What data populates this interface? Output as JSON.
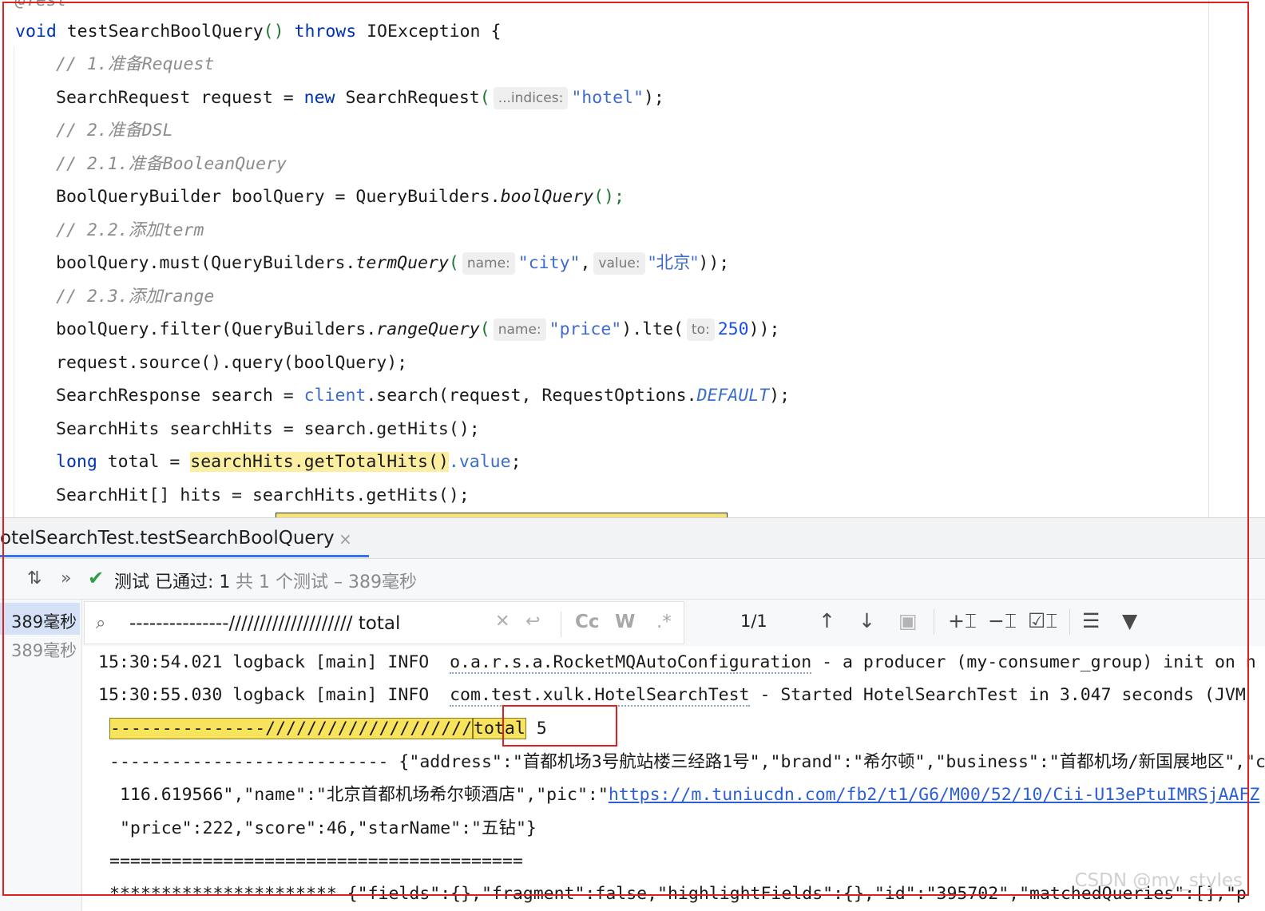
{
  "editor": {
    "line_prev_annotation": "@Test",
    "lines": {
      "method_void": "void",
      "method_name": " testSearchBoolQuery",
      "method_parens": "()",
      "method_throws": " throws",
      "method_exception": " IOException {",
      "comment1": "// 1.准备Request",
      "req_type": "SearchRequest request = ",
      "req_new": "new",
      "req_ctor": " SearchRequest",
      "req_open": "(",
      "req_hint": "...indices:",
      "req_arg": "\"hotel\"",
      "req_close": ");",
      "comment2": "// 2.准备DSL",
      "comment21": "// 2.1.准备BooleanQuery",
      "bq_prefix": "BoolQueryBuilder boolQuery = QueryBuilders.",
      "bq_method": "boolQuery",
      "bq_suffix": "();",
      "comment22": "// 2.2.添加term",
      "must_prefix": "boolQuery.must(QueryBuilders.",
      "must_method": "termQuery",
      "must_open": "(",
      "must_hint1": "name:",
      "must_arg1": "\"city\"",
      "must_comma": ",",
      "must_hint2": "value:",
      "must_arg2": "\"北京\"",
      "must_close": "));",
      "comment23": "// 2.3.添加range",
      "filter_prefix": "boolQuery.filter(QueryBuilders.",
      "filter_method": "rangeQuery",
      "filter_open": "(",
      "filter_hint1": "name:",
      "filter_arg1": "\"price\"",
      "filter_mid": ").lte(",
      "filter_hint2": "to:",
      "filter_arg2": "250",
      "filter_close": "));",
      "source_line": "request.source().query(boolQuery);",
      "resp_prefix": "SearchResponse search = ",
      "resp_client": "client",
      "resp_mid": ".search(request, RequestOptions.",
      "resp_const": "DEFAULT",
      "resp_close": ");",
      "hits_line": "SearchHits searchHits = search.getHits();",
      "total_kw": "long",
      "total_prefix": " total = ",
      "total_call": "searchHits.getTotalHits()",
      "total_field": ".value",
      "total_end": ";",
      "hitarr_line": "SearchHit[] hits = searchHits.getHits();"
    }
  },
  "run_panel": {
    "tab_title": "otelSearchTest.testSearchBoolQuery",
    "tab_close": "×",
    "status_label": "测试 已通过: 1",
    "status_detail": "共 1 个测试 – 389毫秒",
    "tree_selected_time": "389毫秒",
    "tree_child_time": "389毫秒",
    "search_value": "---------------//////////////////// total",
    "match_count": "1/1",
    "opt_case": "Cc",
    "opt_word": "W",
    "opt_regex": ".*"
  },
  "console": {
    "log1_prefix": "15:30:54.021 logback [main] INFO  ",
    "log1_class": "o.a.r.s.a.RocketMQAutoConfiguration",
    "log1_msg": " - a producer (my-consumer_group) init on n",
    "log2_prefix": "15:30:55.030 logback [main] INFO  ",
    "log2_class": "com.test.xulk.HotelSearchTest",
    "log2_msg": " - Started HotelSearchTest in 3.047 seconds (JVM",
    "match_text": "---------------////////////////////",
    "match_total": "total",
    "total_value": " 5",
    "json_line1": "--------------------------- {\"address\":\"首都机场3号航站楼三经路1号\",\"brand\":\"希尔顿\",\"business\":\"首都机场/新国展地区\",\"c",
    "json_line2_prefix": " 116.619566\",\"name\":\"北京首都机场希尔顿酒店\",\"pic\":\"",
    "json_line2_link": "https://m.tuniucdn.com/fb2/t1/G6/M00/52/10/Cii-U13ePtuIMRSjAAFZ",
    "json_line3": " \"price\":222,\"score\":46,\"starName\":\"五钻\"}",
    "equals_line": "========================================",
    "stars_line": "********************** {\"fields\":{},\"fragment\":false,\"highlightFields\":{},\"id\":\"395702\",\"matchedQueries\":[],\"p"
  },
  "watermark": "CSDN @my_styles",
  "colors": {
    "keyword": "#0033b3",
    "string": "#067d17",
    "comment": "#8c8c8c",
    "pass_green": "#2f9e44",
    "find_highlight": "#f8e45c",
    "annotation_red": "#e02020",
    "accent": "#3574f0"
  }
}
